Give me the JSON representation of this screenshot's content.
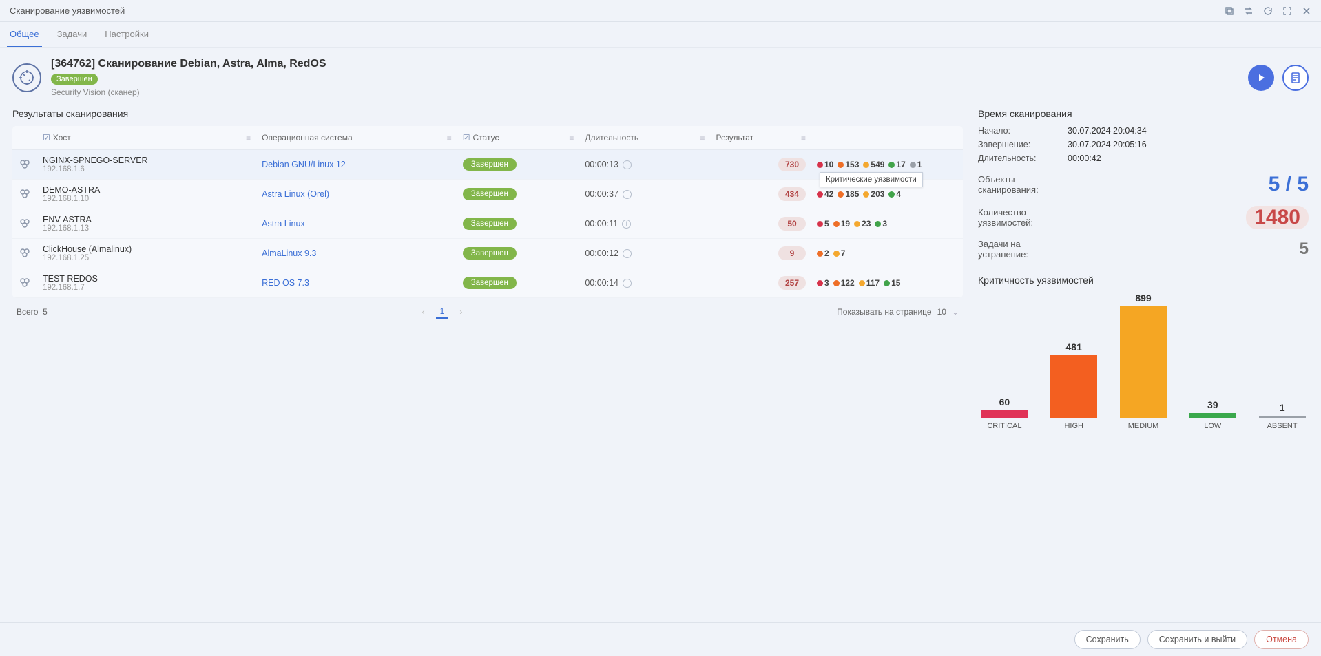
{
  "window_title": "Сканирование уязвимостей",
  "tabs": {
    "items": [
      "Общее",
      "Задачи",
      "Настройки"
    ],
    "active": 0
  },
  "header": {
    "title": "[364762] Сканирование Debian, Astra, Alma, RedOS",
    "status": "Завершен",
    "subtitle": "Security Vision (сканер)"
  },
  "results_title": "Результаты сканирования",
  "columns": {
    "host": "Хост",
    "os": "Операционная система",
    "status": "Статус",
    "duration": "Длительность",
    "result": "Результат"
  },
  "rows": [
    {
      "host": "NGINX-SPNEGO-SERVER",
      "ip": "192.168.1.6",
      "os": "Debian GNU/Linux 12",
      "status": "Завершен",
      "duration": "00:00:13",
      "total": "730",
      "sev": [
        {
          "cls": "c-crit",
          "v": "10"
        },
        {
          "cls": "c-high",
          "v": "153"
        },
        {
          "cls": "c-med",
          "v": "549"
        },
        {
          "cls": "c-low",
          "v": "17"
        },
        {
          "cls": "c-abs",
          "v": "1"
        }
      ],
      "tooltip": "Критические уязвимости"
    },
    {
      "host": "DEMO-ASTRA",
      "ip": "192.168.1.10",
      "os": "Astra Linux (Orel)",
      "status": "Завершен",
      "duration": "00:00:37",
      "total": "434",
      "sev": [
        {
          "cls": "c-crit",
          "v": "42"
        },
        {
          "cls": "c-high",
          "v": "185"
        },
        {
          "cls": "c-med",
          "v": "203"
        },
        {
          "cls": "c-low",
          "v": "4"
        }
      ]
    },
    {
      "host": "ENV-ASTRA",
      "ip": "192.168.1.13",
      "os": "Astra Linux",
      "status": "Завершен",
      "duration": "00:00:11",
      "total": "50",
      "sev": [
        {
          "cls": "c-crit",
          "v": "5"
        },
        {
          "cls": "c-high",
          "v": "19"
        },
        {
          "cls": "c-med",
          "v": "23"
        },
        {
          "cls": "c-low",
          "v": "3"
        }
      ]
    },
    {
      "host": "ClickHouse (Almalinux)",
      "ip": "192.168.1.25",
      "os": "AlmaLinux 9.3",
      "status": "Завершен",
      "duration": "00:00:12",
      "total": "9",
      "sev": [
        {
          "cls": "c-high",
          "v": "2"
        },
        {
          "cls": "c-med",
          "v": "7"
        }
      ]
    },
    {
      "host": "TEST-REDOS",
      "ip": "192.168.1.7",
      "os": "RED OS 7.3",
      "status": "Завершен",
      "duration": "00:00:14",
      "total": "257",
      "sev": [
        {
          "cls": "c-crit",
          "v": "3"
        },
        {
          "cls": "c-high",
          "v": "122"
        },
        {
          "cls": "c-med",
          "v": "117"
        },
        {
          "cls": "c-low",
          "v": "15"
        }
      ]
    }
  ],
  "pager": {
    "total_label": "Всего",
    "total_value": "5",
    "page": "1",
    "per_page_label": "Показывать на странице",
    "per_page_value": "10"
  },
  "side": {
    "time_title": "Время сканирования",
    "start_label": "Начало:",
    "start_value": "30.07.2024 20:04:34",
    "end_label": "Завершение:",
    "end_value": "30.07.2024 20:05:16",
    "dur_label": "Длительность:",
    "dur_value": "00:00:42",
    "objects_label": "Объекты сканирования:",
    "objects_value": "5 / 5",
    "vuln_label": "Количество уязвимостей:",
    "vuln_value": "1480",
    "tasks_label": "Задачи на устранение:",
    "tasks_value": "5",
    "chart_title": "Критичность уязвимостей"
  },
  "chart_data": {
    "type": "bar",
    "categories": [
      "CRITICAL",
      "HIGH",
      "MEDIUM",
      "LOW",
      "ABSENT"
    ],
    "values": [
      60,
      481,
      899,
      39,
      1
    ],
    "colors": [
      "#e03257",
      "#f35f20",
      "#f5a623",
      "#3aa84c",
      "#9aa0a8"
    ],
    "title": "Критичность уязвимостей",
    "xlabel": "",
    "ylabel": "",
    "ylim": [
      0,
      899
    ]
  },
  "footer": {
    "save": "Сохранить",
    "save_exit": "Сохранить и выйти",
    "cancel": "Отмена"
  }
}
